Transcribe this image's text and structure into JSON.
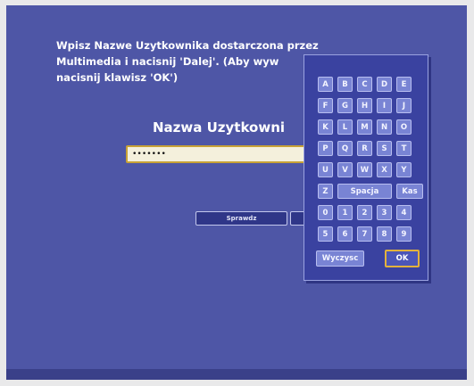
{
  "instructions": "Wpisz Nazwe Uzytkownika dostarczona przez\nMultimedia i nacisnij 'Dalej'. (Aby wyw\nnacisnij klawisz 'OK')",
  "field_title": "Nazwa Uzytkowni",
  "username_value": "•••••••",
  "check_button": "Sprawdz",
  "keyboard": {
    "rows": [
      [
        "A",
        "B",
        "C",
        "D",
        "E"
      ],
      [
        "F",
        "G",
        "H",
        "I",
        "J"
      ],
      [
        "K",
        "L",
        "M",
        "N",
        "O"
      ],
      [
        "P",
        "Q",
        "R",
        "S",
        "T"
      ],
      [
        "U",
        "V",
        "W",
        "X",
        "Y"
      ]
    ],
    "z_key": "Z",
    "space_key": "Spacja",
    "delete_key": "Kas",
    "digits_row1": [
      "0",
      "1",
      "2",
      "3",
      "4"
    ],
    "digits_row2": [
      "5",
      "6",
      "7",
      "8",
      "9"
    ],
    "clear_key": "Wyczysc",
    "ok_key": "OK"
  },
  "colors": {
    "background": "#4e56a6",
    "key": "#7984d4",
    "focus": "#e3b23c"
  }
}
